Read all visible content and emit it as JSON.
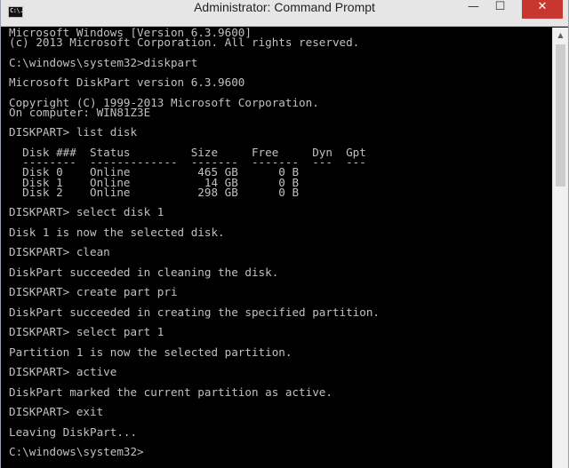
{
  "window": {
    "title": "Administrator: Command Prompt",
    "icon_text": "C:\\.",
    "controls": {
      "minimize": "—",
      "maximize": "☐",
      "close": "✕"
    }
  },
  "scrollbar": {
    "up_arrow": "▲"
  },
  "console": {
    "lines": [
      "Microsoft Windows [Version 6.3.9600]",
      "(c) 2013 Microsoft Corporation. All rights reserved.",
      "",
      "C:\\windows\\system32>diskpart",
      "",
      "Microsoft DiskPart version 6.3.9600",
      "",
      "Copyright (C) 1999-2013 Microsoft Corporation.",
      "On computer: WIN81Z3E",
      "",
      "DISKPART> list disk",
      "",
      "  Disk ###  Status         Size     Free     Dyn  Gpt",
      "  --------  -------------  -------  -------  ---  ---",
      "  Disk 0    Online          465 GB      0 B",
      "  Disk 1    Online           14 GB      0 B",
      "  Disk 2    Online          298 GB      0 B",
      "",
      "DISKPART> select disk 1",
      "",
      "Disk 1 is now the selected disk.",
      "",
      "DISKPART> clean",
      "",
      "DiskPart succeeded in cleaning the disk.",
      "",
      "DISKPART> create part pri",
      "",
      "DiskPart succeeded in creating the specified partition.",
      "",
      "DISKPART> select part 1",
      "",
      "Partition 1 is now the selected partition.",
      "",
      "DISKPART> active",
      "",
      "DiskPart marked the current partition as active.",
      "",
      "DISKPART> exit",
      "",
      "Leaving DiskPart...",
      "",
      "C:\\windows\\system32>"
    ]
  }
}
